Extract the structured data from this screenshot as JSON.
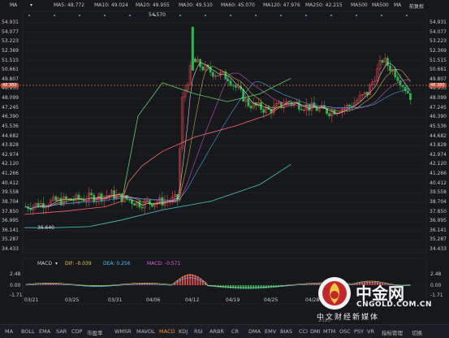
{
  "top": {
    "symbol_label": "MA",
    "right_label": "前复权",
    "ma": [
      {
        "label": "MA5: 48.772",
        "color": "#f4f4f4"
      },
      {
        "label": "MA10: 49.024",
        "color": "#e8c650"
      },
      {
        "label": "MA20: 49.955",
        "color": "#e45ad9"
      },
      {
        "label": "MA30: 49.510",
        "color": "#51c0ff"
      },
      {
        "label": "MA60: 45.070",
        "color": "#57d364"
      },
      {
        "label": "MA120: 47.976",
        "color": "#ff6a6a"
      },
      {
        "label": "MA250: 42.215",
        "color": "#44c8c8"
      },
      {
        "label": "MA500",
        "color": "#888888"
      },
      {
        "label": "MA500",
        "color": "#888888"
      },
      {
        "label": "MA",
        "color": "#888888"
      }
    ]
  },
  "price_axis": [
    "54.931",
    "54.077",
    "53.223",
    "52.369",
    "51.515",
    "50.661",
    "49.807",
    "48.953",
    "48.099",
    "47.245",
    "46.390",
    "45.536",
    "44.682",
    "43.828",
    "42.974",
    "42.120",
    "41.266",
    "40.412",
    "39.558",
    "38.704",
    "37.850",
    "36.995",
    "36.141",
    "35.287",
    "34.433"
  ],
  "current_price_left": "48.380",
  "current_price_right": "48.380",
  "annotations": {
    "high": "54.570",
    "low": "36.640"
  },
  "macd": {
    "title": "MACD",
    "dif": "DIF: -0.039",
    "dea": "DEA: 0.256",
    "macd": "MACD: -0.571",
    "axis": [
      "2.48",
      "0.00",
      "-1.71"
    ],
    "axis_right": [
      "2.48",
      "0.00",
      "-1.71"
    ]
  },
  "date_axis": [
    "03/21",
    "03/25",
    "03/31",
    "04/06",
    "04/12",
    "04/19",
    "04/25",
    "04/28"
  ],
  "date_axis_right": "2025",
  "indicators": [
    "MA",
    "BOLL",
    "EMA",
    "SAR",
    "CDP",
    "市盈率",
    "WMSR",
    "MAVOL",
    "MACD",
    "KDJ",
    "RSI",
    "ARBR",
    "CR",
    "DMA",
    "EMV",
    "BIAS",
    "CCI",
    "DMI",
    "MTM",
    "OSC",
    "PSY",
    "VR",
    "指标管理",
    "切换"
  ],
  "active_indicator": "MACD",
  "watermark": {
    "brand": "中金网",
    "url": "CNGOLD.COM.CN",
    "slogan": "中文财经新媒体"
  },
  "chart_data": {
    "type": "candlestick",
    "title": "",
    "xlabel": "",
    "ylabel": "",
    "ylim": [
      34.433,
      54.931
    ],
    "x": [
      "03/21",
      "03/25",
      "03/31",
      "04/06",
      "04/12",
      "04/19",
      "04/25",
      "04/28"
    ],
    "series": [
      {
        "name": "MA5",
        "last": 48.772
      },
      {
        "name": "MA10",
        "last": 49.024
      },
      {
        "name": "MA20",
        "last": 49.955
      },
      {
        "name": "MA30",
        "last": 49.51
      },
      {
        "name": "MA60",
        "last": 45.07
      },
      {
        "name": "MA120",
        "last": 47.976
      },
      {
        "name": "MA250",
        "last": 42.215
      }
    ],
    "annotations": {
      "high": 54.57,
      "low": 36.64,
      "last": 48.38
    }
  }
}
